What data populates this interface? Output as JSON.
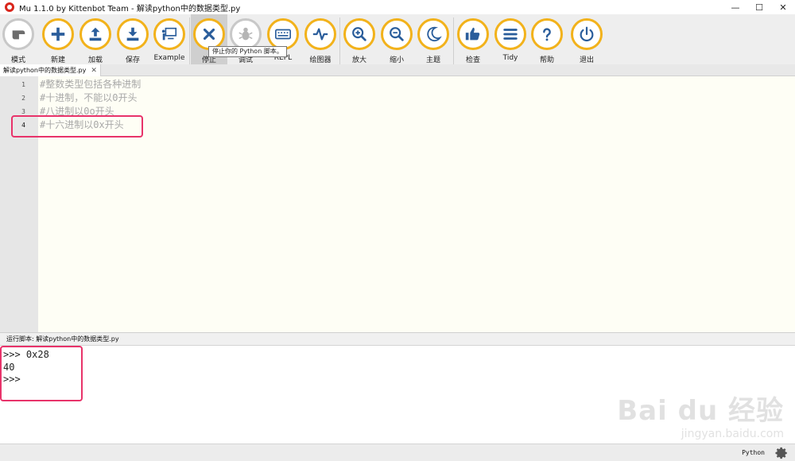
{
  "window": {
    "title": "Mu 1.1.0 by Kittenbot Team - 解读python中的数据类型.py",
    "controls": {
      "minimize": "—",
      "maximize": "☐",
      "close": "✕"
    }
  },
  "toolbar": {
    "buttons": [
      {
        "id": "mode",
        "label": "模式",
        "icon": "mode-icon"
      },
      {
        "id": "new",
        "label": "新建",
        "icon": "plus-icon"
      },
      {
        "id": "load",
        "label": "加载",
        "icon": "upload-icon"
      },
      {
        "id": "save",
        "label": "保存",
        "icon": "download-icon"
      },
      {
        "id": "example",
        "label": "Example",
        "icon": "presentation-icon"
      },
      {
        "id": "stop",
        "label": "停止",
        "icon": "close-icon",
        "active": true
      },
      {
        "id": "debug",
        "label": "调试",
        "icon": "bug-icon",
        "disabled": true
      },
      {
        "id": "repl",
        "label": "REPL",
        "icon": "keyboard-icon"
      },
      {
        "id": "plotter",
        "label": "绘图器",
        "icon": "pulse-icon"
      },
      {
        "id": "zoom_in",
        "label": "放大",
        "icon": "zoom-in-icon"
      },
      {
        "id": "zoom_out",
        "label": "缩小",
        "icon": "zoom-out-icon"
      },
      {
        "id": "theme",
        "label": "主题",
        "icon": "moon-icon"
      },
      {
        "id": "check",
        "label": "检查",
        "icon": "thumbs-up-icon"
      },
      {
        "id": "tidy",
        "label": "Tidy",
        "icon": "lines-icon"
      },
      {
        "id": "help",
        "label": "帮助",
        "icon": "question-icon"
      },
      {
        "id": "quit",
        "label": "退出",
        "icon": "power-icon"
      }
    ],
    "tooltip": "停止你的 Python 脚本。"
  },
  "tabs": [
    {
      "label": "解读python中的数据类型.py",
      "close": "✕"
    }
  ],
  "editor": {
    "lines": [
      {
        "number": "1",
        "text": "#整数类型包括各种进制"
      },
      {
        "number": "2",
        "text": "#十进制，不能以0开头"
      },
      {
        "number": "3",
        "text": "#八进制以0o开头"
      },
      {
        "number": "4",
        "text": "#十六进制以0x开头"
      }
    ]
  },
  "repl": {
    "header": "运行脚本: 解读python中的数据类型.py",
    "lines": [
      ">>> 0x28",
      "40",
      ">>>"
    ]
  },
  "statusbar": {
    "mode": "Python"
  },
  "watermark": {
    "logo": "Bai du 经验",
    "url": "jingyan.baidu.com"
  },
  "colors": {
    "accent": "#f2b21b",
    "icon": "#2a5d9b",
    "highlight": "#e8336a"
  }
}
